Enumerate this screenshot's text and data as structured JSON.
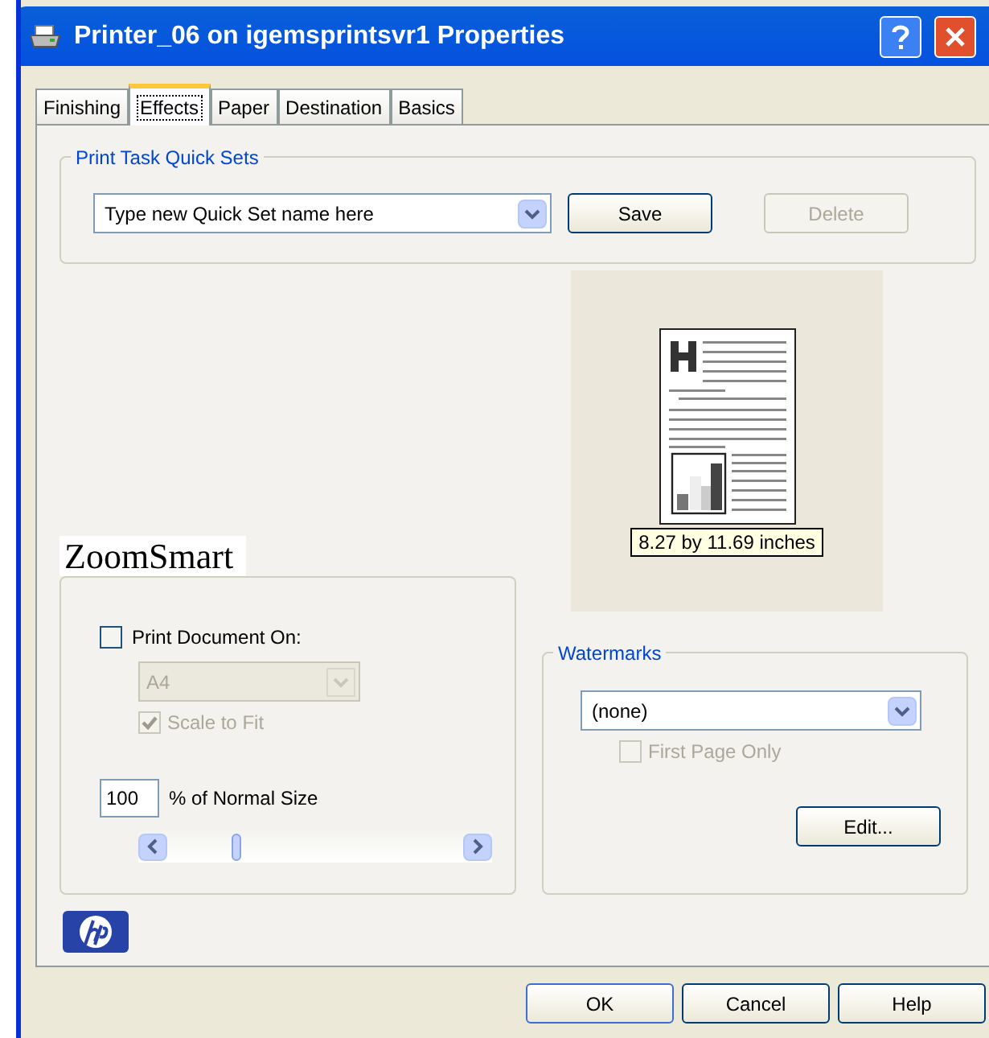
{
  "window": {
    "title": "Printer_06 on igemsprintsvr1 Properties"
  },
  "tabs": [
    {
      "label": "Finishing",
      "selected": false
    },
    {
      "label": "Effects",
      "selected": true
    },
    {
      "label": "Paper",
      "selected": false
    },
    {
      "label": "Destination",
      "selected": false
    },
    {
      "label": "Basics",
      "selected": false
    }
  ],
  "quick_sets": {
    "title": "Print Task Quick Sets",
    "combo_value": "Type new Quick Set name here",
    "buttons": [
      {
        "label": "Save",
        "disabled": false
      },
      {
        "label": "Delete",
        "disabled": true
      }
    ]
  },
  "preview": {
    "size_label": "8.27 by 11.69 inches"
  },
  "zoomsmart": {
    "heading": "ZoomSmart",
    "print_on": {
      "label": "Print Document On:",
      "checked": false
    },
    "paper": {
      "value": "A4",
      "disabled": true
    },
    "scale_to_fit": {
      "label": "Scale to Fit",
      "checked": true,
      "disabled": true
    },
    "percent": "100",
    "percent_label": "% of Normal Size",
    "slider": {
      "level": 0.23
    }
  },
  "watermarks": {
    "title": "Watermarks",
    "value": "(none)",
    "first_page_only": {
      "label": "First Page Only",
      "checked": false,
      "disabled": true
    },
    "edit_button": "Edit..."
  },
  "buttons": [
    "OK",
    "Cancel",
    "Help"
  ]
}
